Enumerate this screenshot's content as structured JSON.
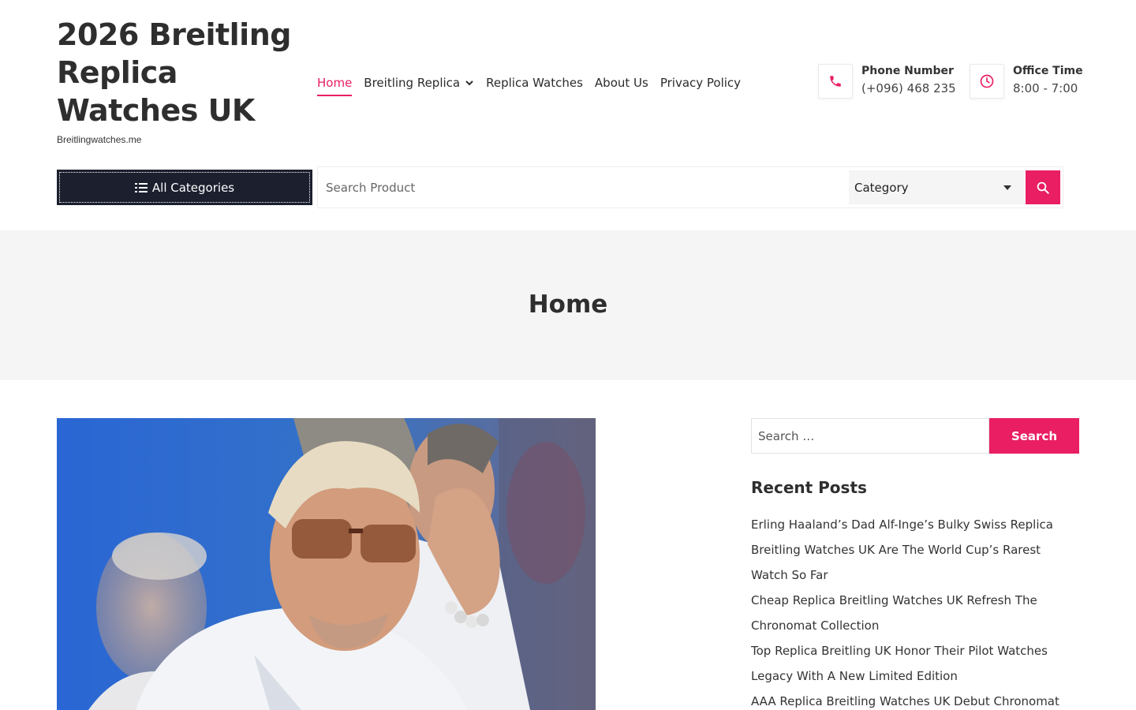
{
  "site": {
    "title": "2026 Breitling Replica Watches UK",
    "description": "Breitlingwatches.me"
  },
  "nav": {
    "items": [
      {
        "label": "Home",
        "active": true
      },
      {
        "label": "Breitling Replica",
        "has_dropdown": true
      },
      {
        "label": "Replica Watches"
      },
      {
        "label": "About Us"
      },
      {
        "label": "Privacy Policy"
      }
    ]
  },
  "contact": {
    "phone_label": "Phone Number",
    "phone_value": "(+096) 468 235",
    "office_label": "Office Time",
    "office_value": "8:00 - 7:00"
  },
  "search_bar": {
    "all_categories_label": "All Categories",
    "placeholder": "Search Product",
    "category_selected": "Category"
  },
  "banner": {
    "title": "Home"
  },
  "sidebar": {
    "search_placeholder": "Search …",
    "search_button": "Search",
    "recent_posts_title": "Recent Posts",
    "recent_posts": [
      "Erling Haaland’s Dad Alf-Inge’s Bulky Swiss Replica",
      "Breitling Watches UK Are The World Cup’s Rarest",
      "Watch So Far",
      "Cheap Replica Breitling Watches UK Refresh The",
      "Chronomat Collection",
      "Top Replica Breitling UK Honor Their Pilot Watches",
      "Legacy With A New Limited Edition",
      "AAA Replica Breitling Watches UK Debut Chronomat"
    ]
  },
  "colors": {
    "accent": "#e91e63",
    "dark_button": "#1b1f2e",
    "banner_bg": "#f5f5f5"
  },
  "icons": {
    "phone": "phone-icon",
    "clock": "clock-icon",
    "list": "list-icon",
    "search": "search-icon",
    "chevron": "chevron-down-icon"
  }
}
